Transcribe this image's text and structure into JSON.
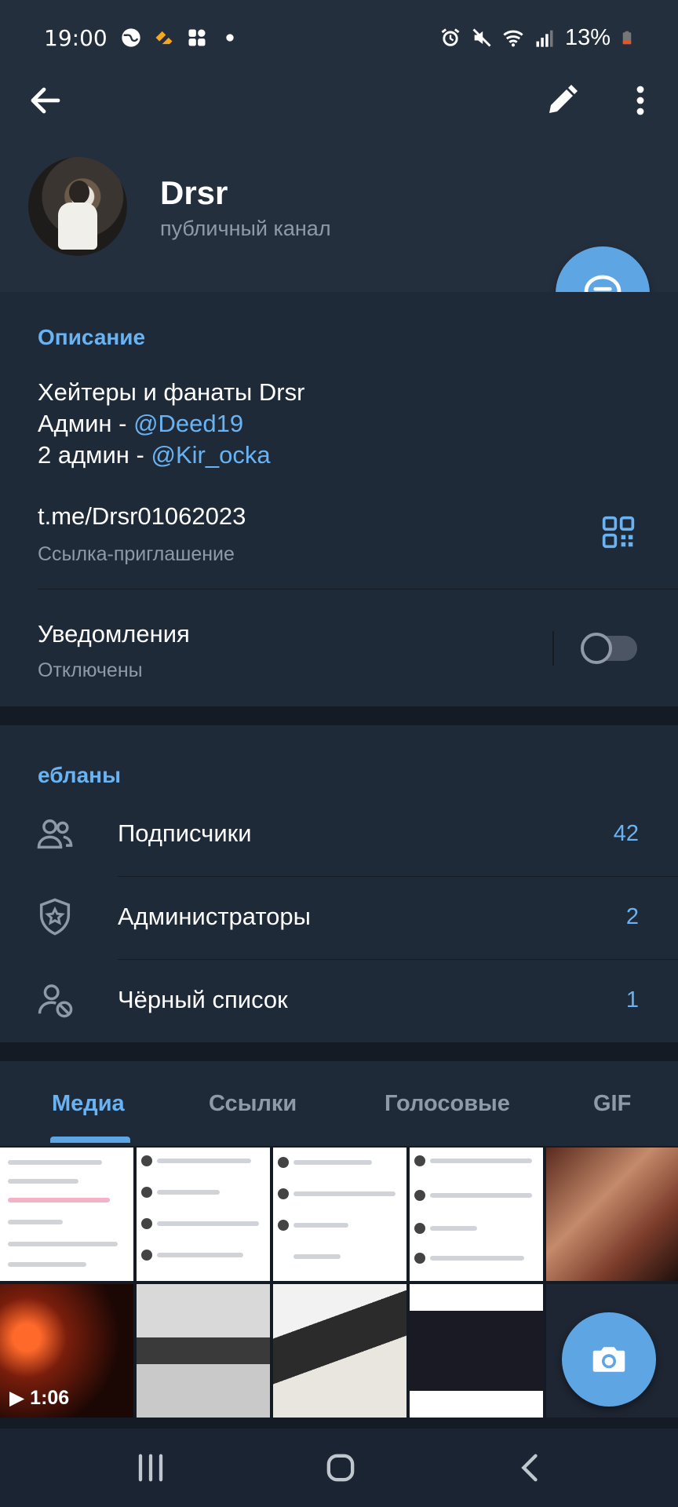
{
  "status_bar": {
    "time": "19:00",
    "battery": "13%",
    "icons_left": [
      "globe-icon",
      "app-icon",
      "grid-icon",
      "dot-icon"
    ],
    "icons_right": [
      "alarm-icon",
      "mute-icon",
      "wifi-icon",
      "signal-icon",
      "battery-icon"
    ]
  },
  "header": {
    "channel_name": "Drsr",
    "channel_type": "публичный канал"
  },
  "info": {
    "section_title": "Описание",
    "description_line1": "Хейтеры и фанаты Drsr",
    "admin_prefix": "Админ - ",
    "admin_mention": "@Deed19",
    "admin2_prefix": "2 админ - ",
    "admin2_mention": "@Kir_ocka",
    "invite_link": "t.me/Drsr01062023",
    "invite_label": "Ссылка-приглашение",
    "notifications_title": "Уведомления",
    "notifications_status": "Отключены",
    "notifications_enabled": false
  },
  "members": {
    "section_title": "ебланы",
    "rows": [
      {
        "label": "Подписчики",
        "count": "42",
        "icon": "users-icon"
      },
      {
        "label": "Администраторы",
        "count": "2",
        "icon": "shield-star-icon"
      },
      {
        "label": "Чёрный список",
        "count": "1",
        "icon": "user-blocked-icon"
      }
    ]
  },
  "tabs": [
    {
      "label": "Медиа",
      "active": true
    },
    {
      "label": "Ссылки",
      "active": false
    },
    {
      "label": "Голосовые",
      "active": false
    },
    {
      "label": "GIF",
      "active": false
    }
  ],
  "media": {
    "video_duration": "1:06"
  },
  "colors": {
    "accent": "#6ab3f3",
    "fab": "#5ea6e3",
    "background": "#1f2a39",
    "header": "#242f3e",
    "muted_text": "#8f9aa6"
  }
}
